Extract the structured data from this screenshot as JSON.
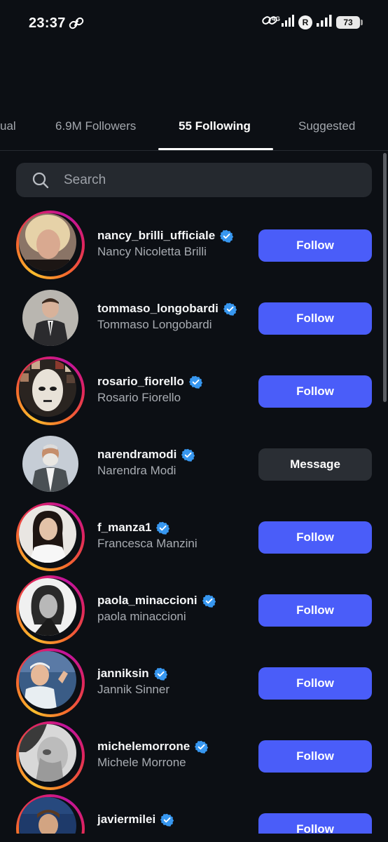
{
  "status_bar": {
    "time": "23:37",
    "network": "4G",
    "carrier_badge": "R",
    "battery": "73",
    "icons": [
      "link-icon",
      "hotspot-icon",
      "signal-icon",
      "battery-icon"
    ]
  },
  "tabs": [
    {
      "label": "ual",
      "active": false
    },
    {
      "label": "6.9M Followers",
      "active": false
    },
    {
      "label": "55 Following",
      "active": true
    },
    {
      "label": "Suggested",
      "active": false
    }
  ],
  "search": {
    "placeholder": "Search",
    "value": ""
  },
  "colors": {
    "background": "#0c0f14",
    "follow_button": "#4a5df9",
    "message_button": "#2a2e34",
    "verified_badge": "#3797f0",
    "story_ring": [
      "#fbbd2d",
      "#f5692c",
      "#e0245e",
      "#c0139e"
    ]
  },
  "accounts": [
    {
      "username": "nancy_brilli_ufficiale",
      "full_name": "Nancy Nicoletta Brilli",
      "verified": true,
      "story_ring": true,
      "button": "Follow"
    },
    {
      "username": "tommaso_longobardi",
      "full_name": "Tommaso Longobardi",
      "verified": true,
      "story_ring": false,
      "button": "Follow"
    },
    {
      "username": "rosario_fiorello",
      "full_name": "Rosario Fiorello",
      "verified": true,
      "story_ring": true,
      "button": "Follow"
    },
    {
      "username": "narendramodi",
      "full_name": "Narendra Modi",
      "verified": true,
      "story_ring": false,
      "button": "Message"
    },
    {
      "username": "f_manza1",
      "full_name": "Francesca Manzini",
      "verified": true,
      "story_ring": true,
      "button": "Follow"
    },
    {
      "username": "paola_minaccioni",
      "full_name": "paola minaccioni",
      "verified": true,
      "story_ring": true,
      "button": "Follow"
    },
    {
      "username": "janniksin",
      "full_name": "Jannik Sinner",
      "verified": true,
      "story_ring": true,
      "button": "Follow"
    },
    {
      "username": "michelemorrone",
      "full_name": "Michele Morrone",
      "verified": true,
      "story_ring": true,
      "button": "Follow"
    },
    {
      "username": "javiermilei",
      "full_name": "",
      "verified": true,
      "story_ring": true,
      "button": "Follow"
    }
  ]
}
